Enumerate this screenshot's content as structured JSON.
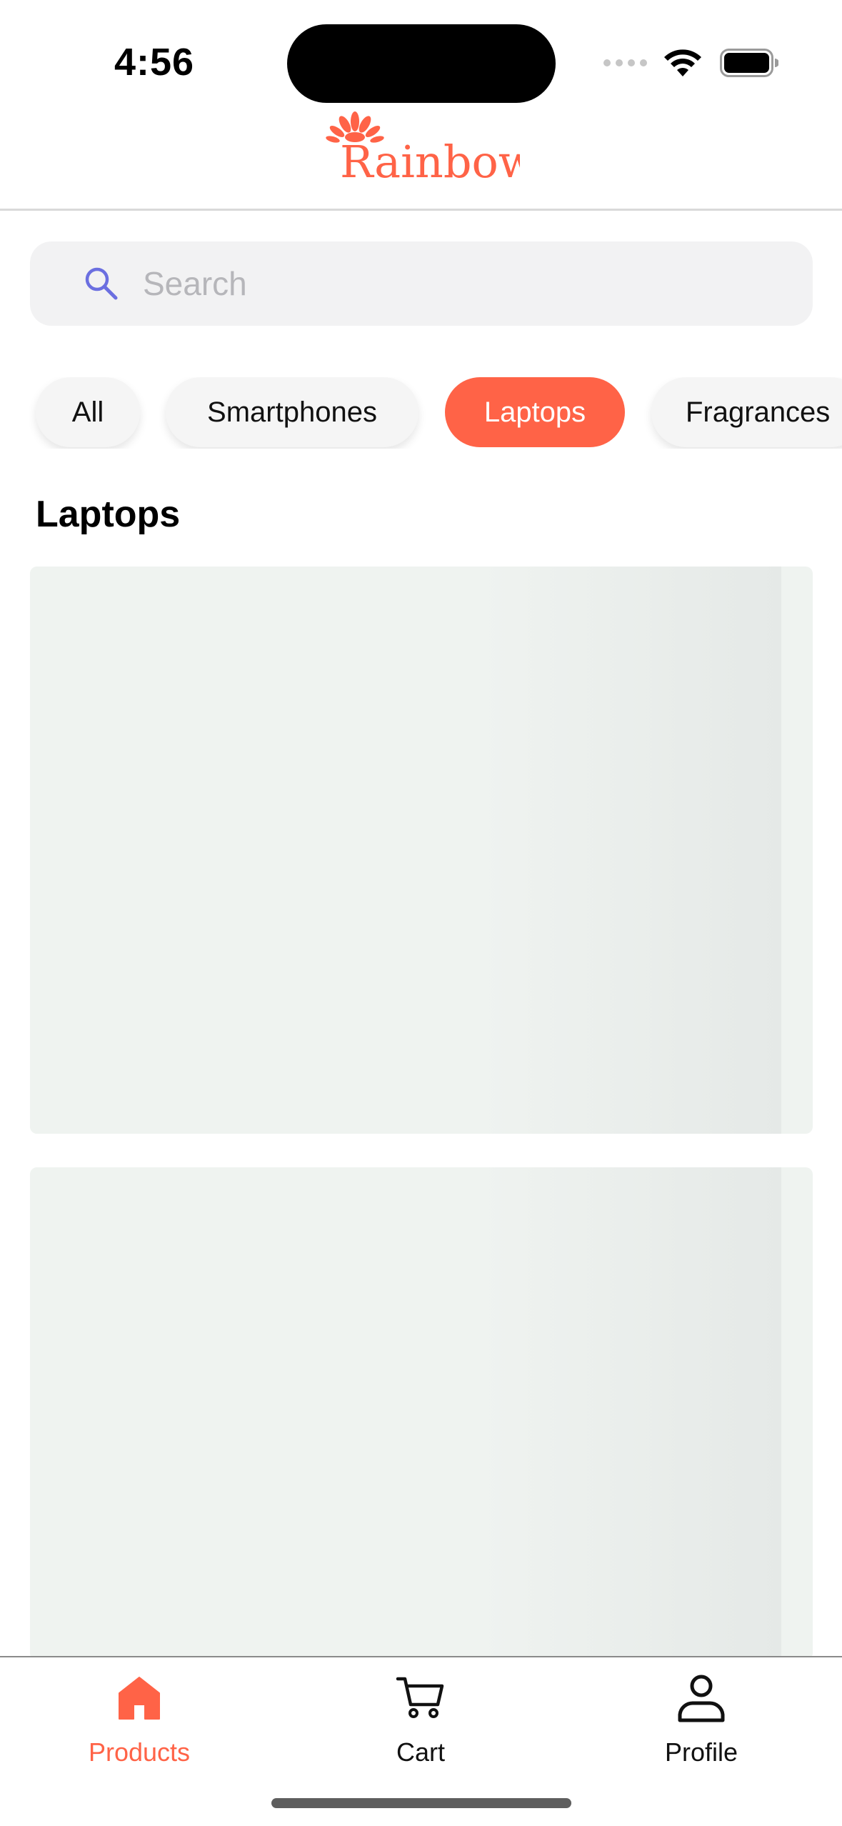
{
  "status_bar": {
    "time": "4:56",
    "icons": [
      "cellular-signal-icon",
      "wifi-icon",
      "battery-icon"
    ]
  },
  "header": {
    "logo_text": "Rainbow",
    "brand_color": "#FF6347"
  },
  "search": {
    "placeholder": "Search",
    "icon": "search-icon",
    "icon_color": "#6B6FE0"
  },
  "categories": {
    "items": [
      "All",
      "Smartphones",
      "Laptops",
      "Fragrances"
    ],
    "selected": "Laptops",
    "active_color": "#FF6347"
  },
  "section": {
    "title": "Laptops"
  },
  "products": {
    "loading_placeholders": 2
  },
  "tab_bar": {
    "items": [
      {
        "label": "Products",
        "icon": "home-icon",
        "active": true
      },
      {
        "label": "Cart",
        "icon": "cart-icon",
        "active": false
      },
      {
        "label": "Profile",
        "icon": "profile-icon",
        "active": false
      }
    ]
  }
}
